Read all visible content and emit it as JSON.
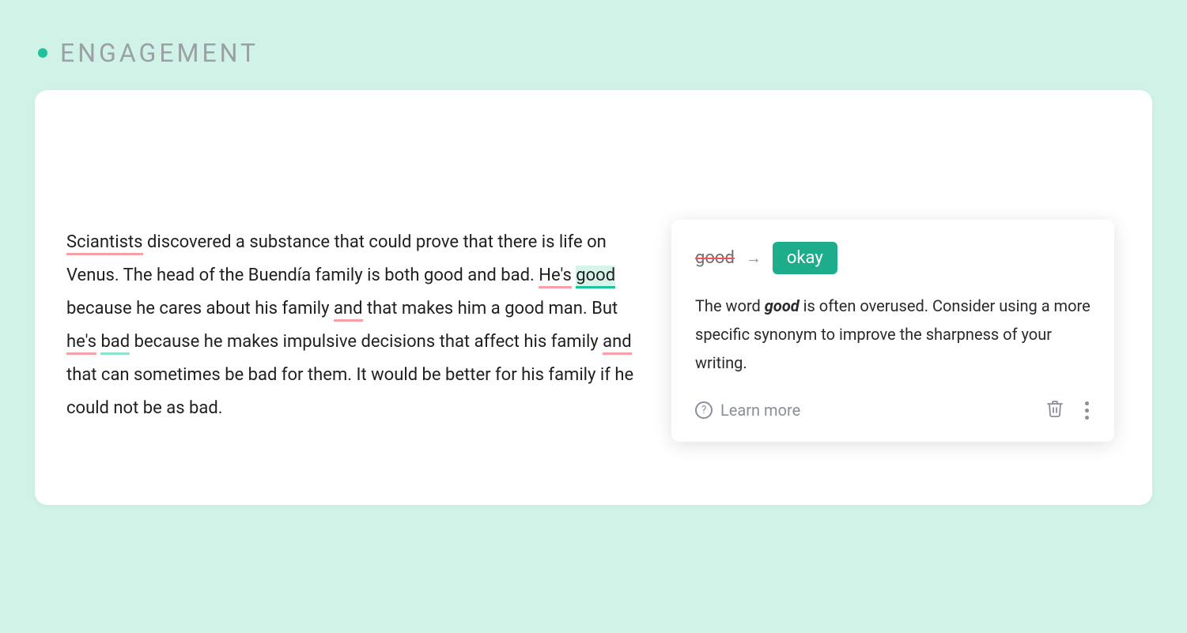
{
  "header": {
    "title": "ENGAGEMENT"
  },
  "editor": {
    "seg1": "Sciantists",
    "seg2": " discovered a substance that could prove that there is life on Venus. The head of the Buendía family is both good and bad. ",
    "seg3": "He's",
    "seg4": " ",
    "seg5": "good",
    "seg6": " because he cares about his family ",
    "seg7": "and",
    "seg8": " that makes him a good man. But ",
    "seg9": "he's",
    "seg10": " ",
    "seg11": "bad",
    "seg12": " because he makes impulsive decisions that affect his family ",
    "seg13": "and",
    "seg14": " that can sometimes be bad for them. It would be better for his family if he could not be as bad."
  },
  "suggestion": {
    "original": "good",
    "replacement": "okay",
    "desc_pre": "The word ",
    "desc_bold": "good",
    "desc_post": " is often overused. Consider using a more specific synonym to improve the sharpness of your writing.",
    "learn_more": "Learn more"
  }
}
